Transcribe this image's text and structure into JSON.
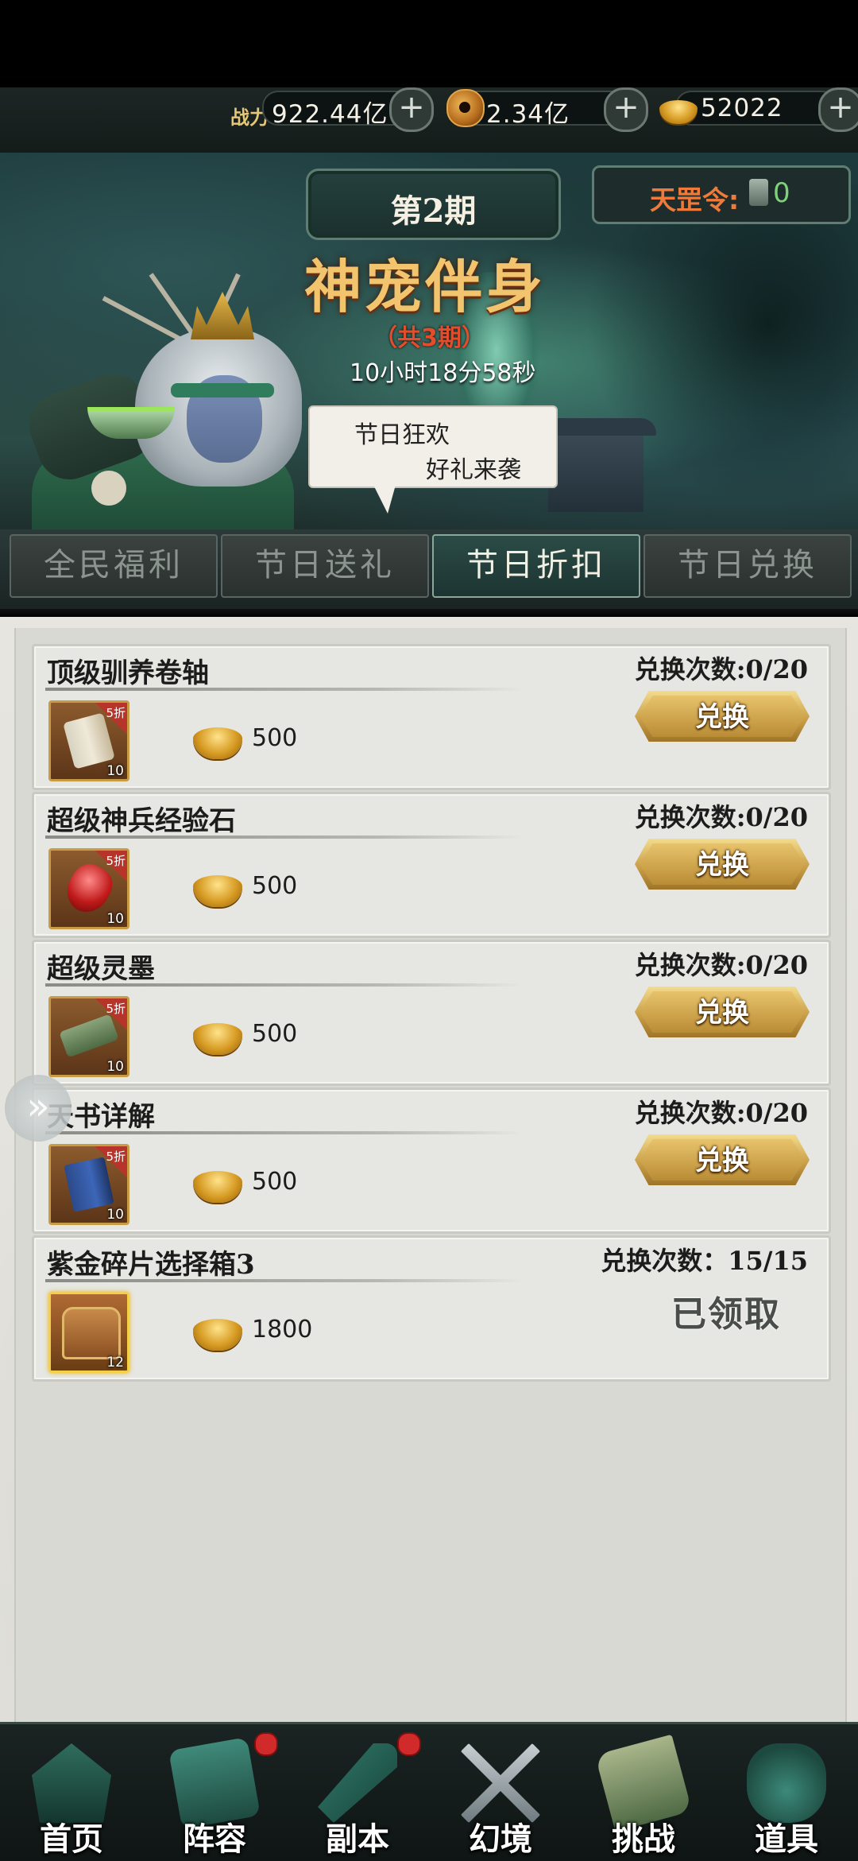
{
  "resources": {
    "power_label": "战力",
    "power_value": "922.44亿",
    "coin_value": "2.34亿",
    "ingot_value": "52022",
    "plus_label": "+"
  },
  "banner": {
    "period": "第2期",
    "token_label": "天罡令:",
    "token_value": "0",
    "event_title": "神宠伴身",
    "event_subtitle": "（共3期）",
    "countdown": "10小时18分58秒",
    "bubble_line1": "节日狂欢",
    "bubble_line2": "好礼来袭"
  },
  "tabs": [
    {
      "label": "全民福利",
      "active": false
    },
    {
      "label": "节日送礼",
      "active": false
    },
    {
      "label": "节日折扣",
      "active": true
    },
    {
      "label": "节日兑换",
      "active": false
    }
  ],
  "exchange_button_label": "兑换",
  "items": [
    {
      "name": "顶级驯养卷轴",
      "count": "兑换次数:0/20",
      "discount": "5折",
      "qty": "10",
      "price": "500",
      "status": "exchange"
    },
    {
      "name": "超级神兵经验石",
      "count": "兑换次数:0/20",
      "discount": "5折",
      "qty": "10",
      "price": "500",
      "status": "exchange"
    },
    {
      "name": "超级灵墨",
      "count": "兑换次数:0/20",
      "discount": "5折",
      "qty": "10",
      "price": "500",
      "status": "exchange"
    },
    {
      "name": "天书详解",
      "count": "兑换次数:0/20",
      "discount": "5折",
      "qty": "10",
      "price": "500",
      "status": "exchange"
    },
    {
      "name": "紫金碎片选择箱3",
      "count": "兑换次数：15/15",
      "discount": "",
      "qty": "12",
      "price": "1800",
      "status": "claimed",
      "claimed_label": "已领取"
    }
  ],
  "side_arrow": "»",
  "nav": [
    {
      "label": "首页",
      "badge": false
    },
    {
      "label": "阵容",
      "badge": true
    },
    {
      "label": "副本",
      "badge": true
    },
    {
      "label": "幻境",
      "badge": false
    },
    {
      "label": "挑战",
      "badge": false
    },
    {
      "label": "道具",
      "badge": false
    }
  ]
}
